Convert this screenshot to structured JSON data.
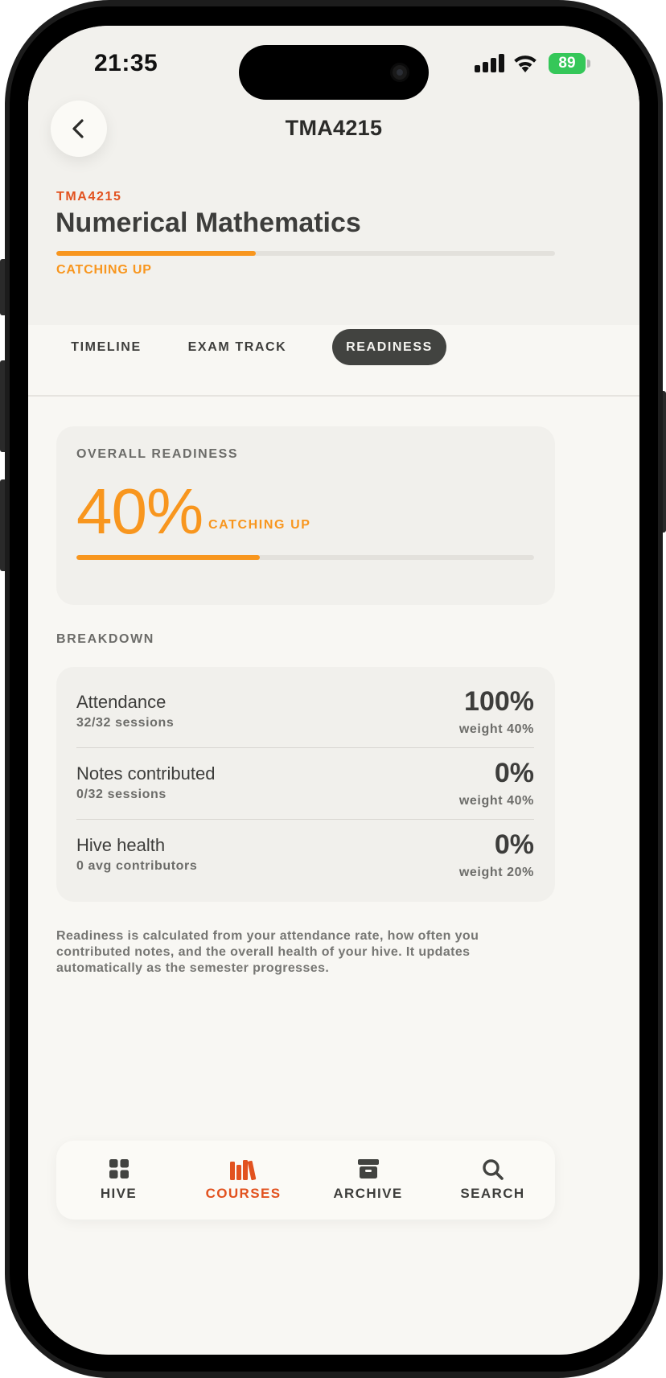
{
  "colors": {
    "accent": "#e2521f",
    "progress": "#f8961e",
    "tab_active_bg": "#424340",
    "battery": "#35c759"
  },
  "status_bar": {
    "time": "21:35",
    "battery": "89",
    "icons": [
      "signal-icon",
      "wifi-icon",
      "battery-charging-icon"
    ]
  },
  "header": {
    "back_icon": "chevron-left-icon",
    "title": "TMA4215"
  },
  "course": {
    "code": "TMA4215",
    "name": "Numerical Mathematics",
    "progress": 0.4,
    "status": "CATCHING UP"
  },
  "tabs": [
    {
      "label": "TIMELINE",
      "active": false
    },
    {
      "label": "EXAM TRACK",
      "active": false
    },
    {
      "label": "READINESS",
      "active": true
    }
  ],
  "overall": {
    "title": "OVERALL READINESS",
    "percent_text": "40%",
    "percent": 0.4,
    "status": "CATCHING UP"
  },
  "breakdown": {
    "title": "BREAKDOWN",
    "rows": [
      {
        "label": "Attendance",
        "detail": "32/32 sessions",
        "value": "100%",
        "weight": "weight 40%"
      },
      {
        "label": "Notes contributed",
        "detail": "0/32 sessions",
        "value": "0%",
        "weight": "weight 40%"
      },
      {
        "label": "Hive health",
        "detail": "0 avg contributors",
        "value": "0%",
        "weight": "weight 20%"
      }
    ]
  },
  "footnote": "Readiness is calculated from your attendance rate, how often you contributed notes, and the overall health of your hive. It updates automatically as the semester progresses.",
  "bottom_nav": [
    {
      "label": "HIVE",
      "icon": "grid-icon",
      "active": false
    },
    {
      "label": "COURSES",
      "icon": "books-icon",
      "active": true
    },
    {
      "label": "ARCHIVE",
      "icon": "archive-box-icon",
      "active": false
    },
    {
      "label": "SEARCH",
      "icon": "search-icon",
      "active": false
    }
  ]
}
